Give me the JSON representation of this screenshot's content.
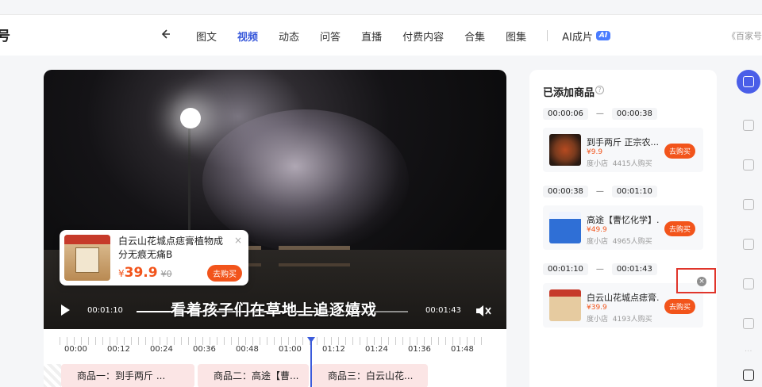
{
  "nav": {
    "brand_stub": "号",
    "items": [
      {
        "label": "图文",
        "active": false
      },
      {
        "label": "视频",
        "active": true
      },
      {
        "label": "动态",
        "active": false
      },
      {
        "label": "问答",
        "active": false
      },
      {
        "label": "直播",
        "active": false
      },
      {
        "label": "付费内容",
        "active": false
      },
      {
        "label": "合集",
        "active": false
      },
      {
        "label": "图集",
        "active": false
      }
    ],
    "ai_label": "AI成片",
    "ai_badge": "AI",
    "right_text": "《百家号"
  },
  "video": {
    "subtitle": "看着孩子们在草地上追逐嬉戏",
    "current_time": "00:01:10",
    "total_time": "00:01:43",
    "progress": 0.68,
    "popup": {
      "title": "白云山花城点痣膏植物成分无痕无痛B",
      "currency": "¥",
      "price": "39.9",
      "original_price": "¥0",
      "buy_label": "去购买",
      "close_label": "×"
    }
  },
  "timeline": {
    "ticks": [
      "00:00",
      "00:12",
      "00:24",
      "00:36",
      "00:48",
      "01:00",
      "01:12",
      "01:24",
      "01:36",
      "01:48"
    ],
    "segments": [
      {
        "label": "商品一：到手两斤 ..."
      },
      {
        "label": "商品二：高途【曹..."
      },
      {
        "label": "商品三：白云山花..."
      }
    ]
  },
  "panel": {
    "title": "已添加商品",
    "items": [
      {
        "start": "00:00:06",
        "end": "00:00:38",
        "name": "到手两斤 正宗农...",
        "price": "¥9.9",
        "shop": "度小店",
        "buyers": "4415人购买",
        "buy_label": "去购买",
        "thumb": "food"
      },
      {
        "start": "00:00:38",
        "end": "00:01:10",
        "name": "高途【曹忆化学】...",
        "price": "¥49.9",
        "shop": "度小店",
        "buyers": "4965人购买",
        "buy_label": "去购买",
        "thumb": "book"
      },
      {
        "start": "00:01:10",
        "end": "00:01:43",
        "name": "白云山花城点痣膏...",
        "price": "¥39.9",
        "shop": "度小店",
        "buyers": "4193人购买",
        "buy_label": "去购买",
        "thumb": "herb"
      }
    ],
    "dash": "—"
  },
  "icons": {
    "back": "back-arrow-icon",
    "help": "help-circle-icon",
    "remove": "remove-circle-icon",
    "play": "play-icon",
    "mute": "mute-icon"
  }
}
